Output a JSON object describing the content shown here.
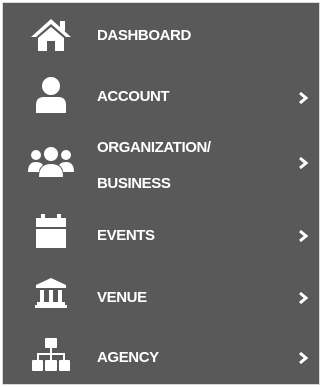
{
  "menu": {
    "items": [
      {
        "id": "dashboard",
        "label": "DASHBOARD",
        "icon": "home-icon",
        "has_submenu": false
      },
      {
        "id": "account",
        "label": "ACCOUNT",
        "icon": "user-icon",
        "has_submenu": true
      },
      {
        "id": "organization",
        "label_line1": "ORGANIZATION/",
        "label_line2": "BUSINESS",
        "icon": "users-group-icon",
        "has_submenu": true
      },
      {
        "id": "events",
        "label": "EVENTS",
        "icon": "calendar-icon",
        "has_submenu": true
      },
      {
        "id": "venue",
        "label": "VENUE",
        "icon": "building-columns-icon",
        "has_submenu": true
      },
      {
        "id": "agency",
        "label": "AGENCY",
        "icon": "sitemap-icon",
        "has_submenu": true
      }
    ]
  },
  "colors": {
    "background": "#595959",
    "text": "#ffffff",
    "border": "#d9d9d9"
  }
}
